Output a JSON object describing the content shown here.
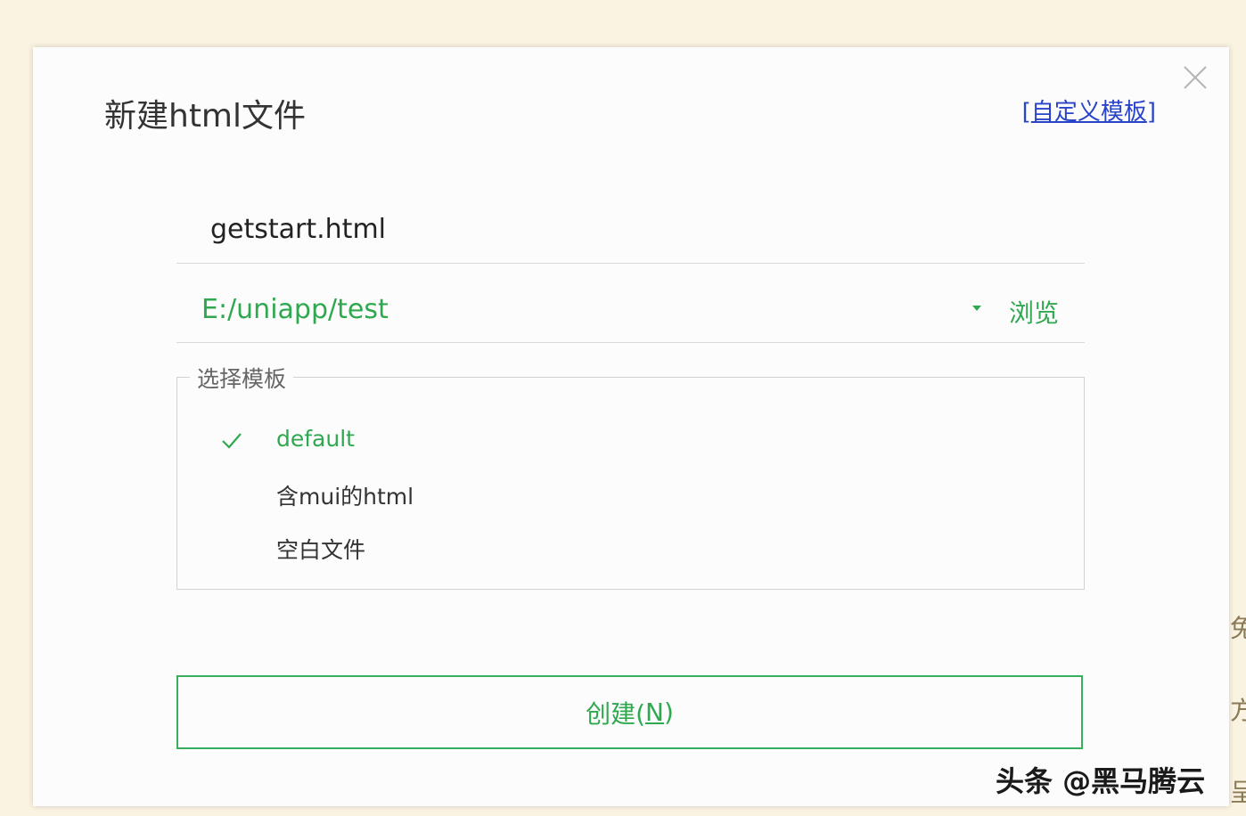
{
  "dialog": {
    "title": "新建html文件",
    "custom_template_link": {
      "open_bracket": "[",
      "text": "自定义模板",
      "close_bracket": "]"
    },
    "close_icon": "close-icon"
  },
  "filename": {
    "value": "getstart.html"
  },
  "path": {
    "value": "E:/uniapp/test",
    "dropdown_icon": "caret-down-icon",
    "browse_label": "浏览"
  },
  "template_group": {
    "legend": "选择模板",
    "items": [
      {
        "label": "default",
        "selected": true
      },
      {
        "label": "含mui的html",
        "selected": false
      },
      {
        "label": "空白文件",
        "selected": false
      }
    ]
  },
  "create_button": {
    "label_prefix": "创建(",
    "hotkey": "N",
    "label_suffix": ")"
  },
  "watermark": "头条 @黑马腾云",
  "background_side_text": [
    "免",
    "方",
    "呈"
  ],
  "colors": {
    "accent_green": "#2fa84f",
    "link_blue": "#2a44c8",
    "page_background": "#fbf3e2",
    "dialog_background": "#fcfcfd"
  }
}
